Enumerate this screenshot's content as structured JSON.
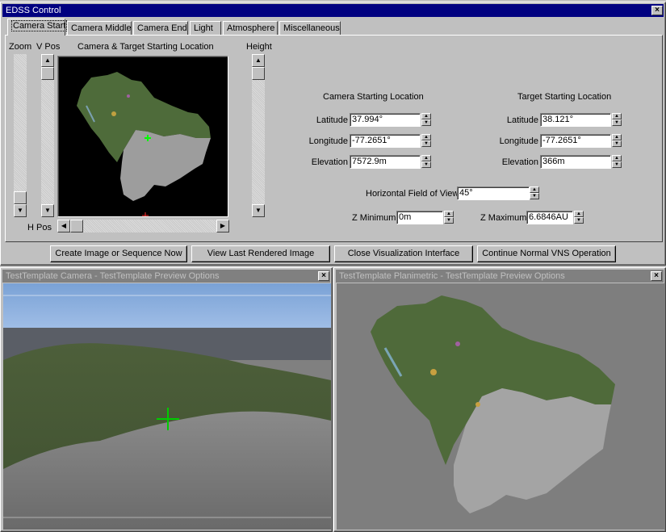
{
  "window": {
    "title": "EDSS Control"
  },
  "tabs": [
    {
      "label": "Camera Start",
      "active": true
    },
    {
      "label": "Camera Middle"
    },
    {
      "label": "Camera End"
    },
    {
      "label": "Light"
    },
    {
      "label": "Atmosphere"
    },
    {
      "label": "Miscellaneous"
    }
  ],
  "location_panel": {
    "zoom_label": "Zoom",
    "vpos_label": "V Pos",
    "map_title": "Camera & Target Starting Location",
    "height_label": "Height",
    "hpos_label": "H Pos"
  },
  "camera": {
    "heading": "Camera Starting Location",
    "latitude_label": "Latitude",
    "latitude": "37.994°",
    "longitude_label": "Longitude",
    "longitude": "-77.2651°",
    "elevation_label": "Elevation",
    "elevation": "7572.9m"
  },
  "target": {
    "heading": "Target Starting Location",
    "latitude_label": "Latitude",
    "latitude": "38.121°",
    "longitude_label": "Longitude",
    "longitude": "-77.2651°",
    "elevation_label": "Elevation",
    "elevation": "366m"
  },
  "view": {
    "fov_label": "Horizontal Field of View",
    "fov": "45°",
    "zmin_label": "Z Minimum",
    "zmin": "0m",
    "zmax_label": "Z Maximum",
    "zmax": "6.6846AU"
  },
  "buttons": {
    "create": "Create Image or Sequence Now",
    "view_last": "View Last Rendered Image",
    "close_vis": "Close Visualization Interface",
    "continue": "Continue Normal VNS Operation"
  },
  "preview_camera": {
    "title": "TestTemplate Camera - TestTemplate Preview Options"
  },
  "preview_plan": {
    "title": "TestTemplate Planimetric - TestTemplate Preview Options"
  },
  "icons": {
    "close": "close-icon",
    "up": "arrow-up-icon",
    "down": "arrow-down-icon",
    "left": "arrow-left-icon",
    "right": "arrow-right-icon"
  }
}
